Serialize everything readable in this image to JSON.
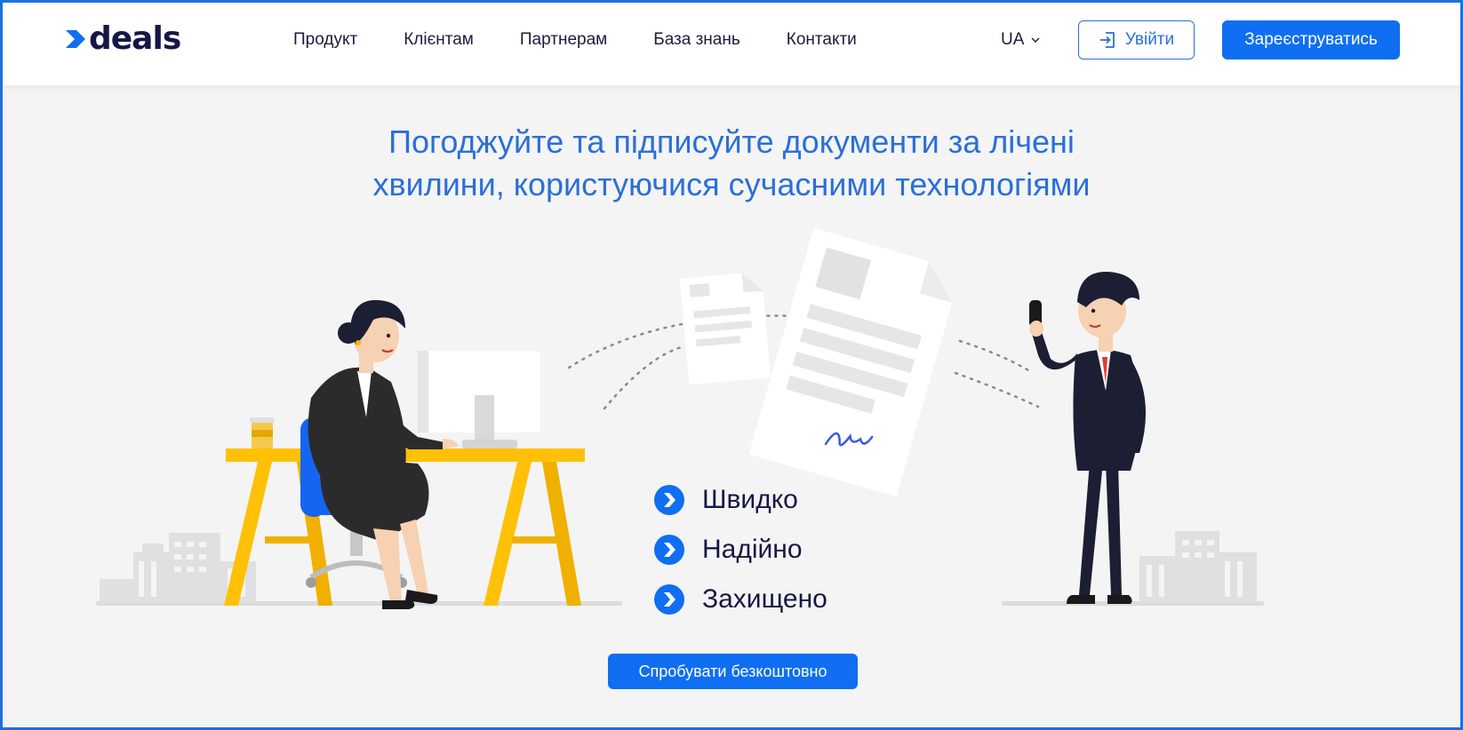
{
  "brand": {
    "name": "deals",
    "accent": "#0f6ef2",
    "dark": "#151744"
  },
  "nav": {
    "items": [
      {
        "label": "Продукт"
      },
      {
        "label": "Клієнтам"
      },
      {
        "label": "Партнерам"
      },
      {
        "label": "База знань"
      },
      {
        "label": "Контакти"
      }
    ]
  },
  "header": {
    "language": "UA",
    "login_label": "Увійти",
    "register_label": "Зареєструватись"
  },
  "hero": {
    "headline_line1": "Погоджуйте та підписуйте документи за лічені",
    "headline_line2": "хвилини, користуючися сучасними технологіями",
    "features": [
      {
        "label": "Швидко",
        "icon": "chevron-circle-icon"
      },
      {
        "label": "Надійно",
        "icon": "chevron-circle-icon"
      },
      {
        "label": "Захищено",
        "icon": "chevron-circle-icon"
      }
    ],
    "cta_label": "Спробувати безкоштовно"
  }
}
